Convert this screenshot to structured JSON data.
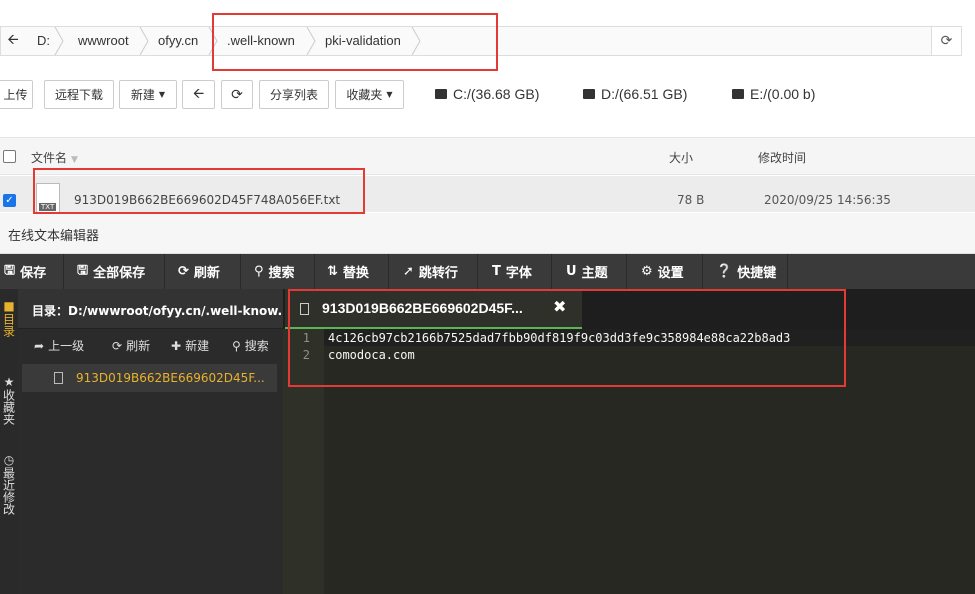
{
  "breadcrumb": {
    "items": [
      "D:",
      "wwwroot",
      "ofyy.cn",
      ".well-known",
      "pki-validation"
    ]
  },
  "toolbar": {
    "upload": "上传",
    "remote_download": "远程下载",
    "new": "新建",
    "refresh_icon": "refresh-icon",
    "share_list": "分享列表",
    "favorites": "收藏夹",
    "drives": [
      "C:/(36.68 GB)",
      "D:/(66.51 GB)",
      "E:/(0.00 b)"
    ]
  },
  "filelist": {
    "col_name": "文件名",
    "col_size": "大小",
    "col_mtime": "修改时间",
    "rows": [
      {
        "name": "913D019B662BE669602D45F748A056EF.txt",
        "size": "78 B",
        "mtime": "2020/09/25 14:56:35",
        "icon_label": "TXT"
      }
    ]
  },
  "editor": {
    "title": "在线文本编辑器",
    "toolbar": [
      "保存",
      "全部保存",
      "刷新",
      "搜索",
      "替换",
      "跳转行",
      "字体",
      "主题",
      "设置",
      "快捷键"
    ],
    "side_tabs": [
      "目录",
      "收藏夹",
      "最近修改"
    ],
    "tree": {
      "dir_label": "目录：D:/wwwroot/ofyy.cn/.well-know...",
      "actions": [
        "上一级",
        "刷新",
        "新建",
        "搜索"
      ],
      "file": "913D019B662BE669602D45F..."
    },
    "tab": {
      "label": "913D019B662BE669602D45F...",
      "close": "✖"
    },
    "code_lines": [
      {
        "num": "1",
        "text": "4c126cb97cb2166b7525dad7fbb90df819f9c03dd3fe9c358984e88ca22b8ad3"
      },
      {
        "num": "2",
        "text": "comodoca.com"
      }
    ]
  }
}
